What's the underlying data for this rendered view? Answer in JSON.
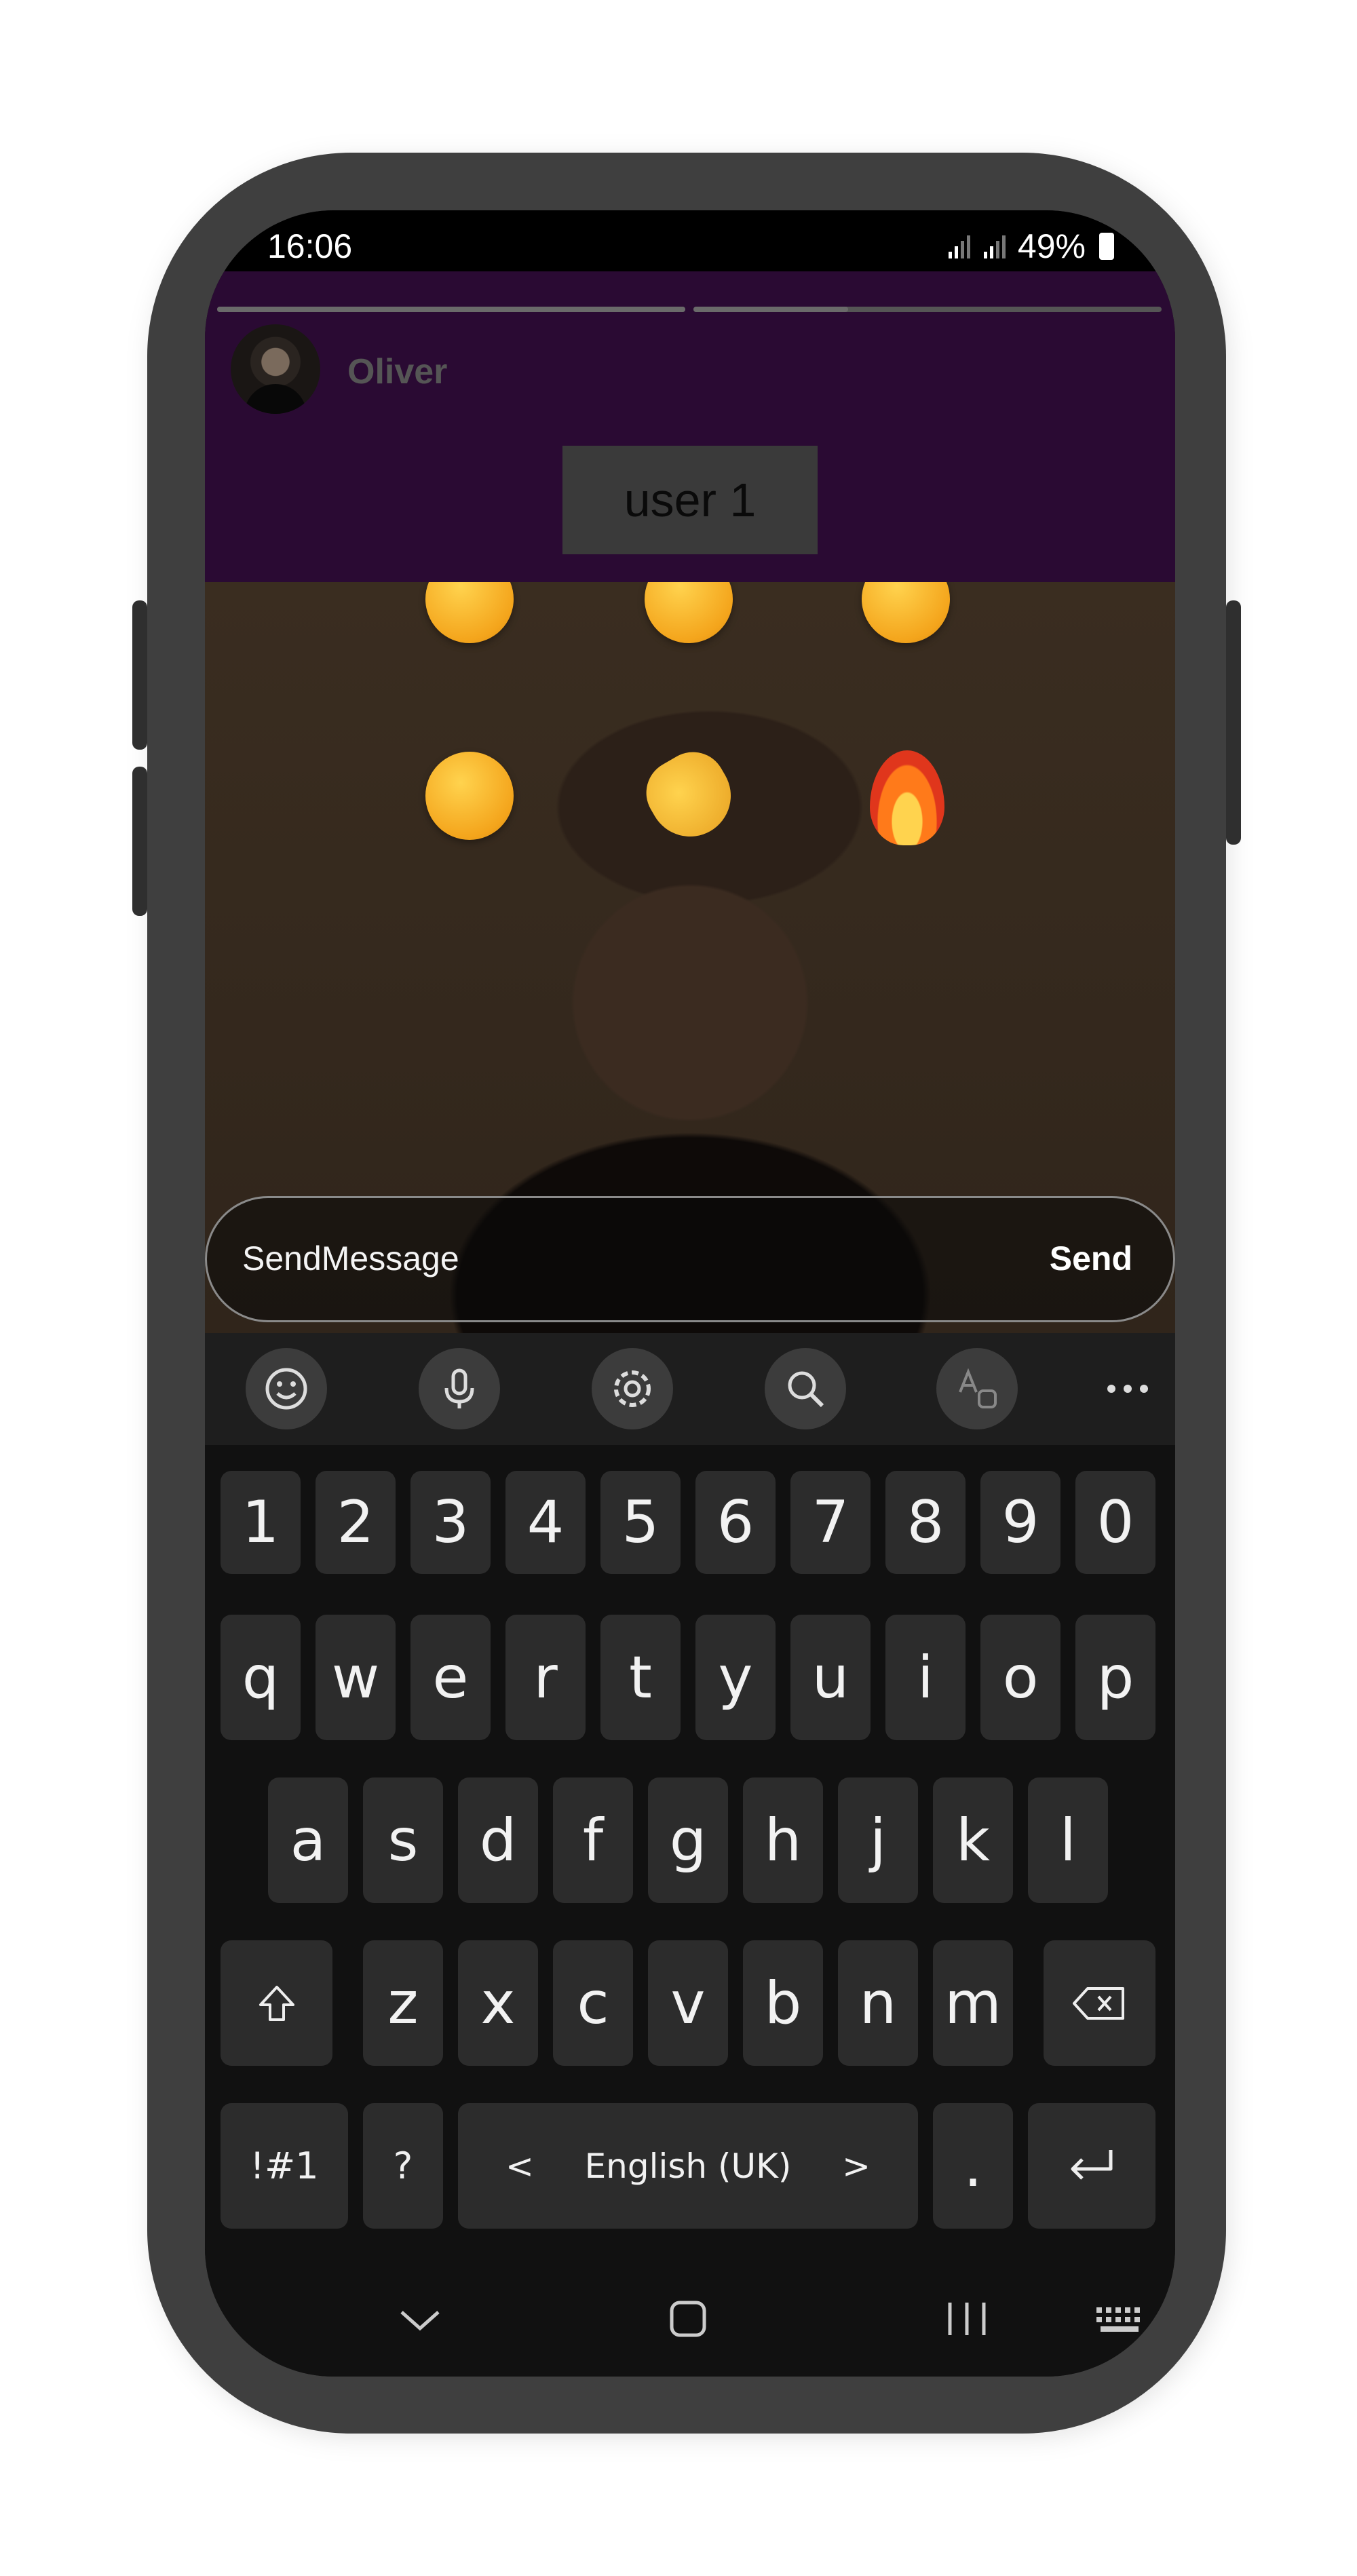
{
  "status_bar": {
    "time": "16:06",
    "battery": "49%"
  },
  "story": {
    "user_name": "Oliver",
    "user_tag": "user 1"
  },
  "reactions": [
    "😂",
    "😮",
    "😍",
    "😢",
    "👏",
    "🔥"
  ],
  "message_bar": {
    "placeholder": "SendMessage",
    "send_label": "Send"
  },
  "keyboard": {
    "numbers": [
      "1",
      "2",
      "3",
      "4",
      "5",
      "6",
      "7",
      "8",
      "9",
      "0"
    ],
    "row1": [
      "q",
      "w",
      "e",
      "r",
      "t",
      "y",
      "u",
      "i",
      "o",
      "p"
    ],
    "row2": [
      "a",
      "s",
      "d",
      "f",
      "g",
      "h",
      "j",
      "k",
      "l"
    ],
    "row3": [
      "z",
      "x",
      "c",
      "v",
      "b",
      "n",
      "m"
    ],
    "symbols_label": "!#1",
    "question_label": "?",
    "language_label": "English (UK)",
    "period_label": ".",
    "lang_prev": "<",
    "lang_next": ">"
  },
  "icons": {
    "toolbar": [
      "emoji-icon",
      "microphone-icon",
      "settings-icon",
      "search-icon",
      "translate-icon",
      "more-icon"
    ],
    "shift": "shift-icon",
    "backspace": "backspace-icon",
    "enter": "enter-icon",
    "navbar": [
      "nav-back-icon",
      "nav-home-icon",
      "nav-recents-icon",
      "keyboard-icon"
    ]
  }
}
